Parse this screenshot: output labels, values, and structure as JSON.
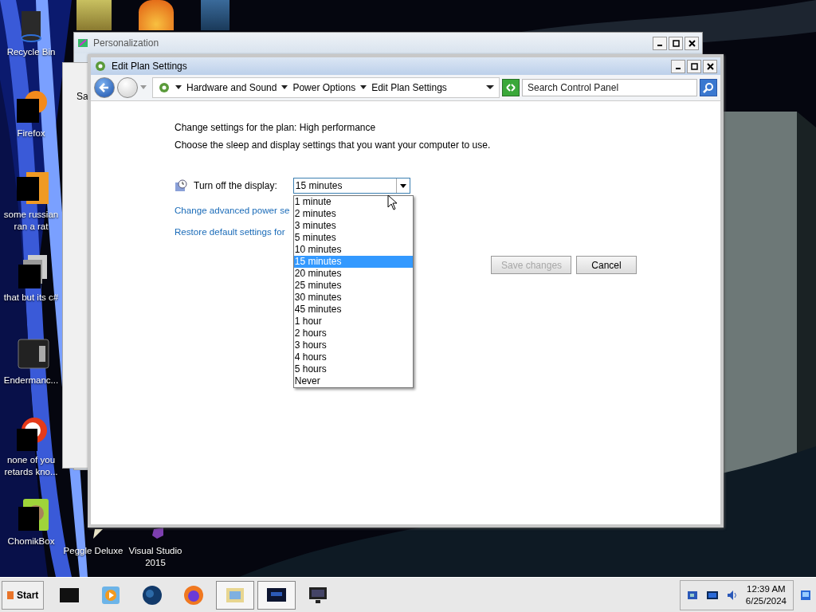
{
  "desktop_icons": [
    {
      "label": "Recycle Bin"
    },
    {
      "label": "Firefox"
    },
    {
      "label": "some russian ran a rat"
    },
    {
      "label": "that but its c#"
    },
    {
      "label": "Endermanc..."
    },
    {
      "label": "none of you retards kno..."
    },
    {
      "label": "ChomikBox"
    },
    {
      "label": "Peggle Deluxe"
    },
    {
      "label": "Visual Studio 2015"
    }
  ],
  "background_window": {
    "title": "Personalization",
    "partial_text": "Sa"
  },
  "window": {
    "title": "Edit Plan Settings",
    "breadcrumbs": [
      "Hardware and Sound",
      "Power Options",
      "Edit Plan Settings"
    ],
    "search": {
      "placeholder": "Search Control Panel"
    },
    "heading": "Change settings for the plan: High performance",
    "description": "Choose the sleep and display settings that you want your computer to use.",
    "setting": {
      "label": "Turn off the display:",
      "value": "15 minutes",
      "expanded": true
    },
    "options": [
      {
        "label": "1 minute",
        "selected": false
      },
      {
        "label": "2 minutes",
        "selected": false
      },
      {
        "label": "3 minutes",
        "selected": false
      },
      {
        "label": "5 minutes",
        "selected": false
      },
      {
        "label": "10 minutes",
        "selected": false
      },
      {
        "label": "15 minutes",
        "selected": true
      },
      {
        "label": "20 minutes",
        "selected": false
      },
      {
        "label": "25 minutes",
        "selected": false
      },
      {
        "label": "30 minutes",
        "selected": false
      },
      {
        "label": "45 minutes",
        "selected": false
      },
      {
        "label": "1 hour",
        "selected": false
      },
      {
        "label": "2 hours",
        "selected": false
      },
      {
        "label": "3 hours",
        "selected": false
      },
      {
        "label": "4 hours",
        "selected": false
      },
      {
        "label": "5 hours",
        "selected": false
      },
      {
        "label": "Never",
        "selected": false
      }
    ],
    "links": [
      "Change advanced power se",
      "Restore default settings for"
    ],
    "buttons": [
      {
        "label": "Save changes",
        "disabled": true
      },
      {
        "label": "Cancel",
        "disabled": false
      }
    ]
  },
  "taskbar": {
    "start": "Start",
    "time": "12:39 AM",
    "date": "6/25/2024"
  }
}
